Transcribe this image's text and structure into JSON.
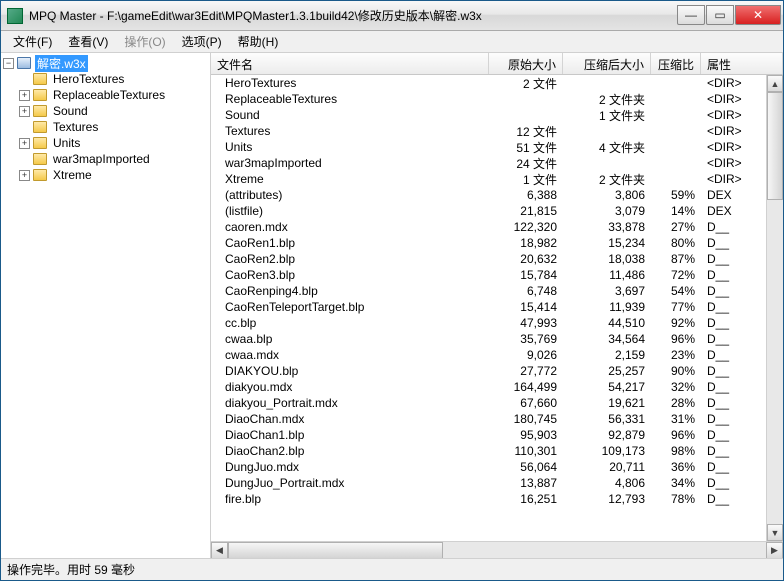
{
  "title": "MPQ Master - F:\\gameEdit\\war3Edit\\MPQMaster1.3.1build42\\修改历史版本\\解密.w3x",
  "menu": {
    "file": "文件(F)",
    "view": "查看(V)",
    "operate": "操作(O)",
    "option": "选项(P)",
    "help": "帮助(H)"
  },
  "tree": {
    "root": "解密.w3x",
    "items": [
      "HeroTextures",
      "ReplaceableTextures",
      "Sound",
      "Textures",
      "Units",
      "war3mapImported",
      "Xtreme"
    ]
  },
  "columns": {
    "name": "文件名",
    "orig": "原始大小",
    "comp": "压缩后大小",
    "ratio": "压缩比",
    "attr": "属性"
  },
  "rows": [
    {
      "name": "HeroTextures",
      "orig": "2 文件",
      "comp": "",
      "ratio": "",
      "attr": "<DIR>"
    },
    {
      "name": "ReplaceableTextures",
      "orig": "",
      "comp": "2 文件夹",
      "ratio": "",
      "attr": "<DIR>"
    },
    {
      "name": "Sound",
      "orig": "",
      "comp": "1 文件夹",
      "ratio": "",
      "attr": "<DIR>"
    },
    {
      "name": "Textures",
      "orig": "12 文件",
      "comp": "",
      "ratio": "",
      "attr": "<DIR>"
    },
    {
      "name": "Units",
      "orig": "51 文件",
      "comp": "4 文件夹",
      "ratio": "",
      "attr": "<DIR>"
    },
    {
      "name": "war3mapImported",
      "orig": "24 文件",
      "comp": "",
      "ratio": "",
      "attr": "<DIR>"
    },
    {
      "name": "Xtreme",
      "orig": "1 文件",
      "comp": "2 文件夹",
      "ratio": "",
      "attr": "<DIR>"
    },
    {
      "name": "(attributes)",
      "orig": "6,388",
      "comp": "3,806",
      "ratio": "59%",
      "attr": "DEX"
    },
    {
      "name": "(listfile)",
      "orig": "21,815",
      "comp": "3,079",
      "ratio": "14%",
      "attr": "DEX"
    },
    {
      "name": "caoren.mdx",
      "orig": "122,320",
      "comp": "33,878",
      "ratio": "27%",
      "attr": "D__"
    },
    {
      "name": "CaoRen1.blp",
      "orig": "18,982",
      "comp": "15,234",
      "ratio": "80%",
      "attr": "D__"
    },
    {
      "name": "CaoRen2.blp",
      "orig": "20,632",
      "comp": "18,038",
      "ratio": "87%",
      "attr": "D__"
    },
    {
      "name": "CaoRen3.blp",
      "orig": "15,784",
      "comp": "11,486",
      "ratio": "72%",
      "attr": "D__"
    },
    {
      "name": "CaoRenping4.blp",
      "orig": "6,748",
      "comp": "3,697",
      "ratio": "54%",
      "attr": "D__"
    },
    {
      "name": "CaoRenTeleportTarget.blp",
      "orig": "15,414",
      "comp": "11,939",
      "ratio": "77%",
      "attr": "D__"
    },
    {
      "name": "cc.blp",
      "orig": "47,993",
      "comp": "44,510",
      "ratio": "92%",
      "attr": "D__"
    },
    {
      "name": "cwaa.blp",
      "orig": "35,769",
      "comp": "34,564",
      "ratio": "96%",
      "attr": "D__"
    },
    {
      "name": "cwaa.mdx",
      "orig": "9,026",
      "comp": "2,159",
      "ratio": "23%",
      "attr": "D__"
    },
    {
      "name": "DIAKYOU.blp",
      "orig": "27,772",
      "comp": "25,257",
      "ratio": "90%",
      "attr": "D__"
    },
    {
      "name": "diakyou.mdx",
      "orig": "164,499",
      "comp": "54,217",
      "ratio": "32%",
      "attr": "D__"
    },
    {
      "name": "diakyou_Portrait.mdx",
      "orig": "67,660",
      "comp": "19,621",
      "ratio": "28%",
      "attr": "D__"
    },
    {
      "name": "DiaoChan.mdx",
      "orig": "180,745",
      "comp": "56,331",
      "ratio": "31%",
      "attr": "D__"
    },
    {
      "name": "DiaoChan1.blp",
      "orig": "95,903",
      "comp": "92,879",
      "ratio": "96%",
      "attr": "D__"
    },
    {
      "name": "DiaoChan2.blp",
      "orig": "110,301",
      "comp": "109,173",
      "ratio": "98%",
      "attr": "D__"
    },
    {
      "name": "DungJuo.mdx",
      "orig": "56,064",
      "comp": "20,711",
      "ratio": "36%",
      "attr": "D__"
    },
    {
      "name": "DungJuo_Portrait.mdx",
      "orig": "13,887",
      "comp": "4,806",
      "ratio": "34%",
      "attr": "D__"
    },
    {
      "name": "fire.blp",
      "orig": "16,251",
      "comp": "12,793",
      "ratio": "78%",
      "attr": "D__"
    }
  ],
  "status": "操作完毕。用时 59 毫秒"
}
